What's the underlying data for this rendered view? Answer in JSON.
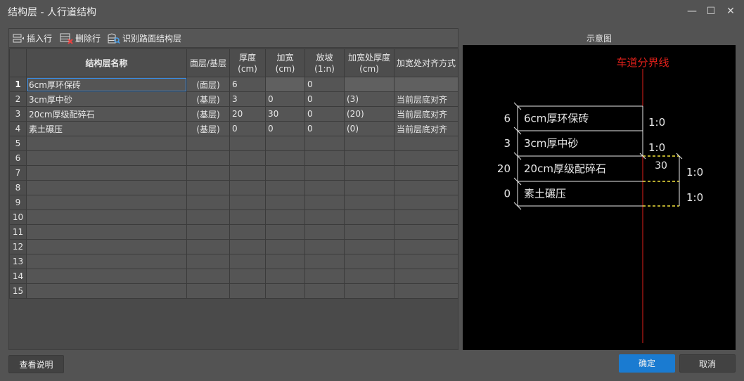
{
  "window": {
    "title": "结构层 - 人行道结构",
    "minimize": "—",
    "maximize": "☐",
    "close": "✕"
  },
  "toolbar": {
    "insert_label": "插入行",
    "delete_label": "删除行",
    "recognize_label": "识别路面结构层"
  },
  "table": {
    "headers": {
      "name": "结构层名称",
      "layer": "面层/基层",
      "thickness": "厚度\n(cm)",
      "widen": "加宽\n(cm)",
      "slope": "放坡\n(1:n)",
      "widen_thickness": "加宽处厚度\n(cm)",
      "align": "加宽处对齐方式"
    },
    "rows": [
      {
        "idx": "1",
        "name": "6cm厚环保砖",
        "layer": "(面层)",
        "thickness": "6",
        "widen": "",
        "slope": "0",
        "widen_thickness": "",
        "align": ""
      },
      {
        "idx": "2",
        "name": "3cm厚中砂",
        "layer": "(基层)",
        "thickness": "3",
        "widen": "0",
        "slope": "0",
        "widen_thickness": "(3)",
        "align": "当前层底对齐"
      },
      {
        "idx": "3",
        "name": "20cm厚级配碎石",
        "layer": "(基层)",
        "thickness": "20",
        "widen": "30",
        "slope": "0",
        "widen_thickness": "(20)",
        "align": "当前层底对齐"
      },
      {
        "idx": "4",
        "name": "素土碾压",
        "layer": "(基层)",
        "thickness": "0",
        "widen": "0",
        "slope": "0",
        "widen_thickness": "(0)",
        "align": "当前层底对齐"
      },
      {
        "idx": "5",
        "name": "",
        "layer": "",
        "thickness": "",
        "widen": "",
        "slope": "",
        "widen_thickness": "",
        "align": ""
      },
      {
        "idx": "6",
        "name": "",
        "layer": "",
        "thickness": "",
        "widen": "",
        "slope": "",
        "widen_thickness": "",
        "align": ""
      },
      {
        "idx": "7",
        "name": "",
        "layer": "",
        "thickness": "",
        "widen": "",
        "slope": "",
        "widen_thickness": "",
        "align": ""
      },
      {
        "idx": "8",
        "name": "",
        "layer": "",
        "thickness": "",
        "widen": "",
        "slope": "",
        "widen_thickness": "",
        "align": ""
      },
      {
        "idx": "9",
        "name": "",
        "layer": "",
        "thickness": "",
        "widen": "",
        "slope": "",
        "widen_thickness": "",
        "align": ""
      },
      {
        "idx": "10",
        "name": "",
        "layer": "",
        "thickness": "",
        "widen": "",
        "slope": "",
        "widen_thickness": "",
        "align": ""
      },
      {
        "idx": "11",
        "name": "",
        "layer": "",
        "thickness": "",
        "widen": "",
        "slope": "",
        "widen_thickness": "",
        "align": ""
      },
      {
        "idx": "12",
        "name": "",
        "layer": "",
        "thickness": "",
        "widen": "",
        "slope": "",
        "widen_thickness": "",
        "align": ""
      },
      {
        "idx": "13",
        "name": "",
        "layer": "",
        "thickness": "",
        "widen": "",
        "slope": "",
        "widen_thickness": "",
        "align": ""
      },
      {
        "idx": "14",
        "name": "",
        "layer": "",
        "thickness": "",
        "widen": "",
        "slope": "",
        "widen_thickness": "",
        "align": ""
      },
      {
        "idx": "15",
        "name": "",
        "layer": "",
        "thickness": "",
        "widen": "",
        "slope": "",
        "widen_thickness": "",
        "align": ""
      }
    ]
  },
  "preview": {
    "label": "示意图",
    "divider_label": "车道分界线",
    "layers": [
      {
        "thickness_label": "6",
        "name": "6cm厚环保砖",
        "slope_label": "1:0"
      },
      {
        "thickness_label": "3",
        "name": "3cm厚中砂",
        "slope_label": "1:0"
      },
      {
        "thickness_label": "20",
        "name": "20cm厚级配碎石",
        "slope_label": "1:0"
      },
      {
        "thickness_label": "0",
        "name": "素土碾压",
        "slope_label": "1:0"
      }
    ],
    "widen_label": "30",
    "colors": {
      "divider": "#e0201a",
      "outline": "#e8e8e8",
      "widen": "#f2e23a"
    }
  },
  "footer": {
    "help_label": "查看说明",
    "ok_label": "确定",
    "cancel_label": "取消"
  },
  "colors": {
    "accent": "#1a7bd1",
    "background": "#535353"
  }
}
